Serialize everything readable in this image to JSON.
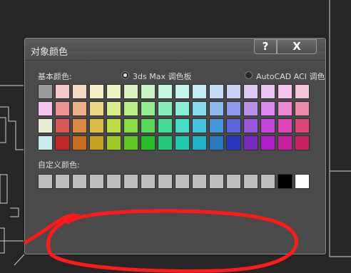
{
  "dialog": {
    "title": "对象颜色",
    "help_label": "?",
    "close_label": "X",
    "basic_colors_label": "基本颜色:",
    "radio_3dsmax_label": "3ds Max 调色板",
    "radio_autocad_label": "AutoCAD ACI 调色",
    "custom_colors_label": "自定义颜色:"
  },
  "colors": {
    "basic_rows": [
      [
        "#9a9a9a",
        "#f4c8c8",
        "#f4dcc4",
        "#f4ecc4",
        "#ecf4c4",
        "#dcf4c4",
        "#c8f4c8",
        "#c4f4dc",
        "#c4f4ec",
        "#c4ecf4",
        "#c4dcf4",
        "#c8d0f4",
        "#dcc8f4",
        "#ecc4f4",
        "#f4c4ec",
        "#f4c4d8"
      ],
      [
        "#f4c4f0",
        "#ec9090",
        "#eeb088",
        "#eed488",
        "#d8ee88",
        "#b8ee88",
        "#90ec90",
        "#88eeb8",
        "#88eed8",
        "#88dcee",
        "#88b8ee",
        "#9098ec",
        "#b890ec",
        "#dc88ee",
        "#ee88d4",
        "#ee88a8"
      ],
      [
        "#e8ecd0",
        "#d85858",
        "#dc8844",
        "#dcbc44",
        "#c0dc44",
        "#88dc44",
        "#58d858",
        "#44dc98",
        "#44dcc4",
        "#44c4dc",
        "#4494dc",
        "#5864d8",
        "#9858d8",
        "#c444dc",
        "#dc44b8",
        "#dc4478"
      ],
      [
        "#c8ecec",
        "#c02828",
        "#c86c20",
        "#c8a020",
        "#a0c820",
        "#60c820",
        "#28c028",
        "#20c878",
        "#20c8b0",
        "#20b0c8",
        "#2878c0",
        "#2838c0",
        "#7828c0",
        "#b020c8",
        "#c820a0",
        "#c82060"
      ]
    ],
    "custom": [
      "#bdbdbd",
      "#bdbdbd",
      "#bdbdbd",
      "#bdbdbd",
      "#bdbdbd",
      "#bdbdbd",
      "#bdbdbd",
      "#bdbdbd",
      "#bdbdbd",
      "#bdbdbd",
      "#bdbdbd",
      "#bdbdbd",
      "#bdbdbd",
      "#bdbdbd",
      "#000000",
      "#ffffff"
    ]
  }
}
